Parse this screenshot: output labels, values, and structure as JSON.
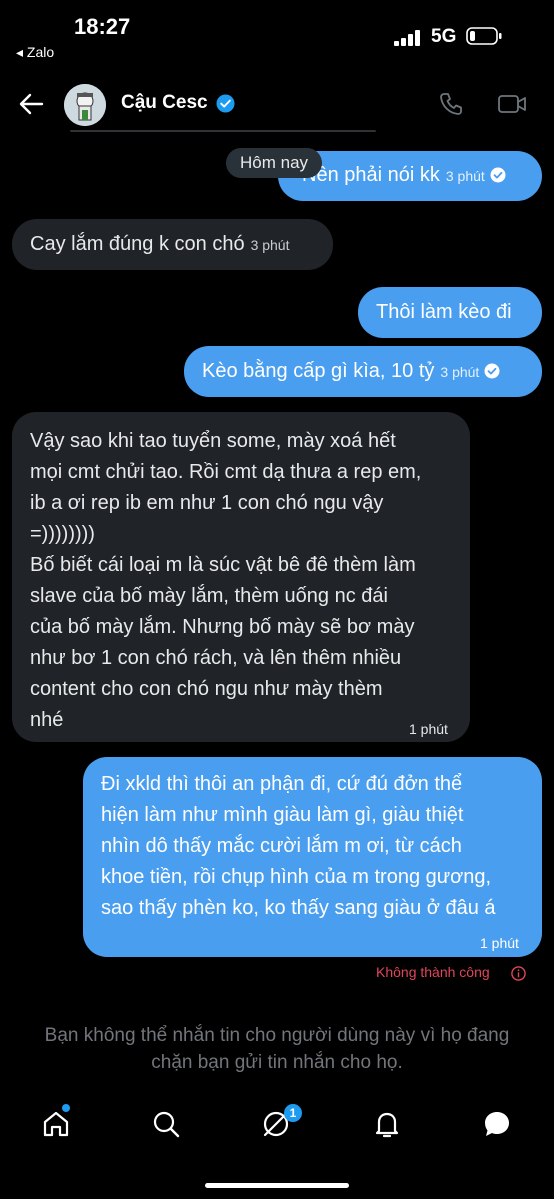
{
  "status_bar": {
    "time": "18:27",
    "back_app": "◂ Zalo",
    "network": "5G"
  },
  "header": {
    "contact_name": "Cậu Cesc"
  },
  "date_separator": "Hôm nay",
  "messages": [
    {
      "direction": "out",
      "text": "Nên phải nói kk",
      "time": "3 phút",
      "read": true
    },
    {
      "direction": "in",
      "text": "Cay lắm đúng k con chó",
      "time": "3 phút"
    },
    {
      "direction": "out",
      "text": "Thôi làm kèo đi",
      "time": ""
    },
    {
      "direction": "out",
      "text": "Kèo bằng cấp gì kìa, 10 tỷ",
      "time": "3 phút",
      "read": true
    },
    {
      "direction": "in",
      "lines": [
        "Vậy sao khi tao tuyển some, mày xoá hết",
        "mọi cmt chửi tao. Rồi cmt dạ thưa a rep em,",
        "ib a ơi rep ib em như 1 con chó ngu vậy",
        "=))))))))",
        "Bố biết cái loại m là súc vật bê đê thèm làm",
        "slave của bố mày lắm, thèm uống nc đái",
        "của bố mày lắm. Nhưng bố mày sẽ bơ mày",
        "như bơ 1 con chó rách, và lên thêm nhiều",
        "content cho con chó ngu như mày thèm",
        "nhé"
      ],
      "time": "1 phút"
    },
    {
      "direction": "out",
      "lines": [
        "Đi xkld thì thôi an phận đi, cứ đú đởn thể",
        "hiện làm như mình giàu làm gì, giàu thiệt",
        "nhìn dô thấy mắc cười lắm m ơi, từ cách",
        "khoe tiền, rồi chụp hình của m trong gương,",
        "sao thấy phèn ko, ko thấy sang giàu ở đâu á"
      ],
      "time": "1 phút"
    }
  ],
  "send_status": "Không thành công",
  "blocked_notice": [
    "Bạn không thể nhắn tin cho người dùng này vì họ đang",
    "chặn bạn gửi tin nhắn cho họ."
  ],
  "bottom_nav": {
    "messages_badge": "1"
  },
  "colors": {
    "outgoing": "#4a9eef",
    "incoming": "#202327",
    "accent": "#1d9bf0",
    "error": "#e0465a"
  },
  "icons": [
    "back-arrow-icon",
    "verified-badge-icon",
    "phone-icon",
    "video-call-icon",
    "read-check-icon",
    "error-info-icon",
    "home-icon",
    "search-icon",
    "communities-icon",
    "bell-icon",
    "messages-icon"
  ]
}
